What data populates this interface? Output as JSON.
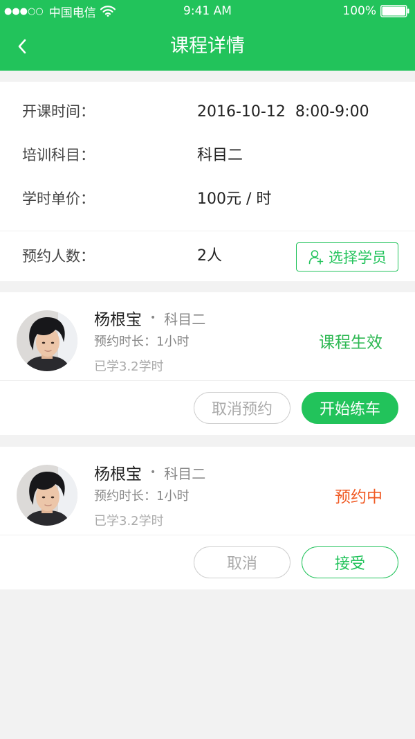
{
  "status_bar": {
    "signal": "●●●○○",
    "carrier": "中国电信",
    "time": "9:41 AM",
    "battery": "100%",
    "battery_level": 1.0
  },
  "nav": {
    "title": "课程详情"
  },
  "course_info": {
    "start_time": {
      "label": "开课时间：",
      "value": "2016-10-12  8:00-9:00"
    },
    "subject": {
      "label": "培训科目：",
      "value": "科目二"
    },
    "price": {
      "label": "学时单价：",
      "value": "100元 / 时"
    },
    "enrollment": {
      "label": "预约人数：",
      "value": "2人",
      "select_button": "选择学员"
    }
  },
  "students": [
    {
      "name": "杨根宝",
      "separator": "•",
      "subject": "科目二",
      "duration": "预约时长：1小时",
      "learned": "已学3.2学时",
      "status": "课程生效",
      "status_color": "#2db852",
      "actions": {
        "secondary": "取消预约",
        "primary": "开始练车"
      }
    },
    {
      "name": "杨根宝",
      "separator": "•",
      "subject": "科目二",
      "duration": "预约时长：1小时",
      "learned": "已学3.2学时",
      "status": "预约中",
      "status_color": "#f05a24",
      "actions": {
        "secondary": "取消",
        "primary": "接受"
      }
    }
  ],
  "icons": {
    "back": "chevron-left-icon",
    "wifi": "wifi-icon",
    "battery": "battery-icon",
    "select_student": "user-add-icon",
    "avatar": "avatar-photo"
  },
  "colors": {
    "brand": "#22c35b",
    "page_background": "#f2f2f2",
    "status_active": "#2db852",
    "status_pending": "#f05a24"
  }
}
